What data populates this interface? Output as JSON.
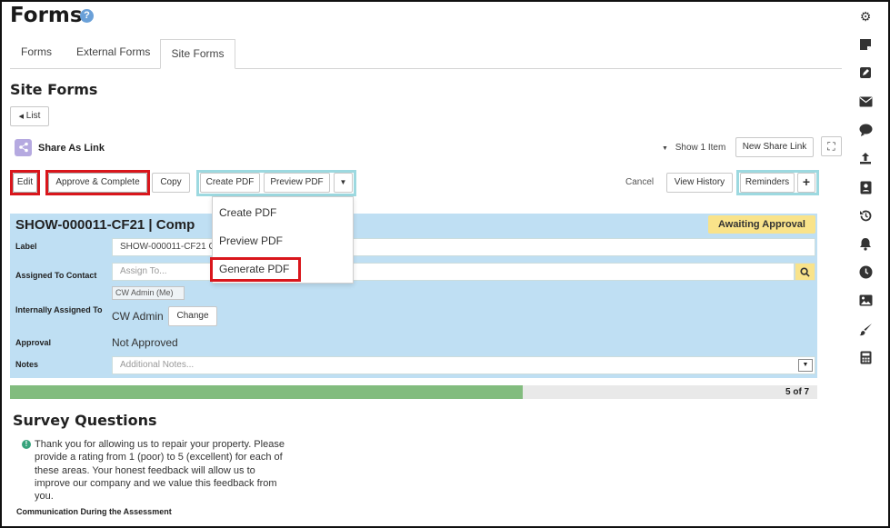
{
  "page": {
    "title": "Forms",
    "help_icon": "?"
  },
  "tabs": [
    {
      "label": "Forms"
    },
    {
      "label": "External Forms"
    },
    {
      "label": "Site Forms"
    }
  ],
  "section": {
    "title": "Site Forms",
    "list_button": "List"
  },
  "share": {
    "label": "Share As Link"
  },
  "top_controls": {
    "show_items": "Show 1 Item",
    "new_share_link": "New Share Link"
  },
  "toolbar": {
    "edit": "Edit",
    "approve_complete": "Approve & Complete",
    "copy": "Copy",
    "create_pdf": "Create PDF",
    "preview_pdf": "Preview PDF",
    "cancel": "Cancel",
    "view_history": "View History",
    "reminders": "Reminders",
    "add": "+"
  },
  "pdf_menu": {
    "items": [
      {
        "label": "Create PDF"
      },
      {
        "label": "Preview PDF"
      },
      {
        "label": "Generate PDF"
      }
    ]
  },
  "form": {
    "title": "SHOW-000011-CF21 | Comp",
    "status": "Awaiting Approval",
    "label_label": "Label",
    "label_value": "SHOW-000011-CF21 Cc",
    "assigned_label": "Assigned To Contact",
    "assigned_placeholder": "Assign To...",
    "assigned_chip": "CW Admin (Me)",
    "internal_label": "Internally Assigned To",
    "internal_value": "CW Admin",
    "change_button": "Change",
    "approval_label": "Approval",
    "approval_value": "Not Approved",
    "notes_label": "Notes",
    "notes_placeholder": "Additional Notes..."
  },
  "progress": {
    "label": "5 of 7",
    "value": 5,
    "total": 7
  },
  "survey": {
    "title": "Survey Questions",
    "intro": "Thank you for allowing us to repair your property. Please provide a rating from 1 (poor) to 5 (excellent) for each of these areas.  Your honest feedback will allow us to improve our company and we value this feedback from you.",
    "subsection": "Communication During the Assessment"
  },
  "sidebar_icons": [
    "gear-icon",
    "sticky-note-icon",
    "pencil-icon",
    "envelope-icon",
    "sms-icon",
    "upload-icon",
    "contact-card-icon",
    "history-icon",
    "bell-icon",
    "clock-icon",
    "image-icon",
    "brush-icon",
    "calculator-icon"
  ],
  "colors": {
    "panel": "#bfdff3",
    "badge": "#f9e38a",
    "progress": "#82bc7e",
    "highlight_red": "#d9161c",
    "highlight_cyan": "#9dd9e0"
  }
}
